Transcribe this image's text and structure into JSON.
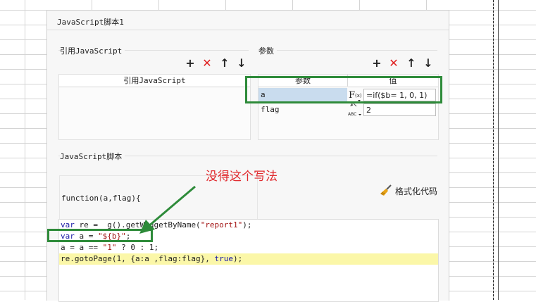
{
  "dialog": {
    "title": "JavaScript脚本1"
  },
  "ref_section": {
    "label": "引用JavaScript",
    "column_header": "引用JavaScript",
    "toolbar": {
      "add": "+",
      "delete": "✕",
      "up": "↑",
      "down": "↓"
    }
  },
  "params_section": {
    "label": "参数",
    "toolbar": {
      "add": "+",
      "delete": "✕",
      "up": "↑",
      "down": "↓"
    },
    "columns": [
      "参数",
      "值"
    ],
    "rows": [
      {
        "name": "a",
        "type_icon": "F(x)",
        "value": "=if($b= 1, 0, 1)"
      },
      {
        "name": "flag",
        "type_icon": "ABC",
        "value": "2"
      }
    ]
  },
  "script_section": {
    "label": "JavaScript脚本",
    "function_signature": "function(a,flag){",
    "format_button": "格式化代码",
    "code": {
      "line1": {
        "kw": "var",
        "mid": " re = _g().getWidgetByName(",
        "str": "\"report1\"",
        "end": ");"
      },
      "line2": {
        "kw": "var",
        "mid": " a = ",
        "str": "\"${b}\"",
        "end": ";"
      },
      "line3": {
        "pre": "a = a == ",
        "str": "\"1\"",
        "end": " ? 0 : 1;"
      },
      "line4": {
        "pre": "re.gotoPage(1, {a:a ,flag:flag}, ",
        "kw": "true",
        "end": ");"
      }
    }
  },
  "annotation": {
    "text": "没得这个写法",
    "color": "#e0282c"
  },
  "colors": {
    "highlight_box": "#2e8b3a",
    "code_highlight": "#fbf7a8",
    "selected_row": "#c9dcee"
  }
}
